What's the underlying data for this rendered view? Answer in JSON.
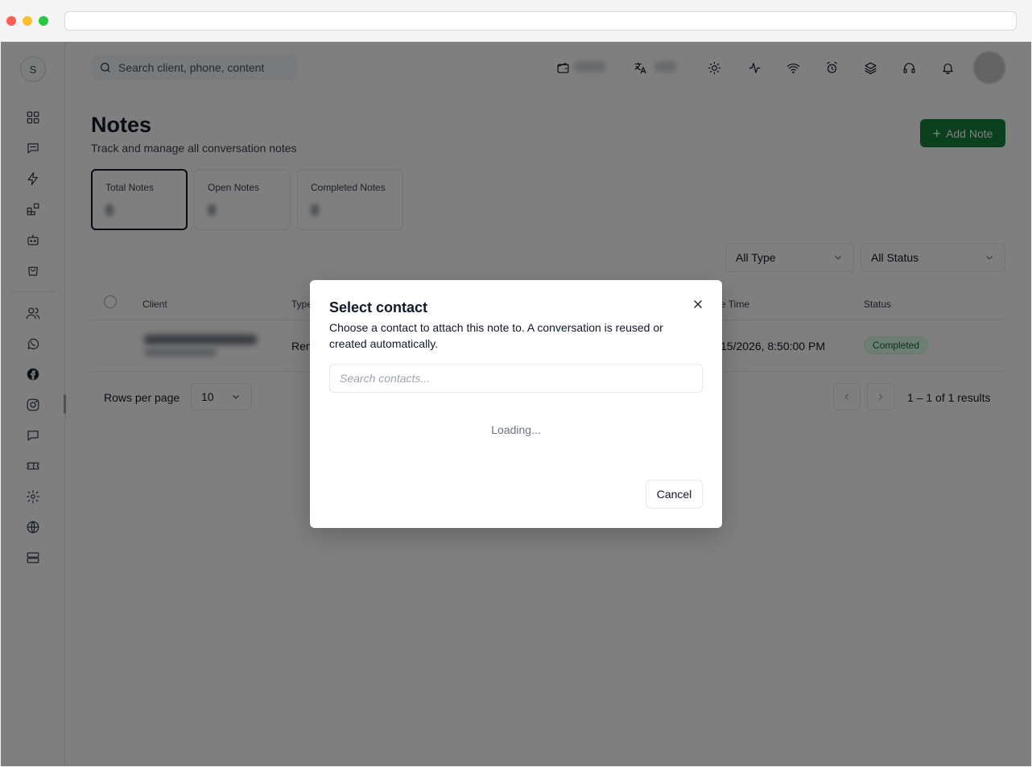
{
  "sidebar": {
    "workspace_initial": "S",
    "items": [
      {
        "name": "dashboard-icon"
      },
      {
        "name": "message-square-icon"
      },
      {
        "name": "zap-icon"
      },
      {
        "name": "blocks-icon"
      },
      {
        "name": "bot-icon"
      },
      {
        "name": "shopping-bag-icon"
      },
      {
        "name": "users-icon"
      },
      {
        "name": "whatsapp-icon"
      },
      {
        "name": "facebook-icon"
      },
      {
        "name": "instagram-icon"
      },
      {
        "name": "chat-icon"
      },
      {
        "name": "ticket-icon"
      },
      {
        "name": "settings-gear-icon"
      },
      {
        "name": "globe-icon"
      },
      {
        "name": "server-icon"
      }
    ]
  },
  "topbar": {
    "search_placeholder": "Search client, phone, content",
    "icons": [
      "wallet-icon",
      "translate-icon",
      "sun-icon",
      "activity-icon",
      "wifi-icon",
      "alarm-clock-icon",
      "layers-icon",
      "headphones-icon",
      "bell-icon"
    ]
  },
  "page": {
    "title": "Notes",
    "subtitle": "Track and manage all conversation notes",
    "add_button": "Add Note"
  },
  "stats": [
    {
      "label": "Total Notes",
      "active": true
    },
    {
      "label": "Open Notes",
      "active": false
    },
    {
      "label": "Completed Notes",
      "active": false
    }
  ],
  "filters": {
    "type": "All Type",
    "status": "All Status"
  },
  "table": {
    "headers": {
      "client": "Client",
      "type": "Type",
      "time": "e Time",
      "status": "Status"
    },
    "rows": [
      {
        "type": "Ren",
        "time": "15/2026, 8:50:00 PM",
        "status": "Completed"
      }
    ]
  },
  "pagination": {
    "rows_label": "Rows per page",
    "rows_value": "10",
    "summary": "1 – 1 of 1 results"
  },
  "modal": {
    "title": "Select contact",
    "description": "Choose a contact to attach this note to. A conversation is reused or created automatically.",
    "search_placeholder": "Search contacts...",
    "loading": "Loading...",
    "cancel": "Cancel"
  },
  "colors": {
    "primary": "#15803d",
    "badge_bg": "#dcfce7",
    "badge_text": "#166534"
  }
}
